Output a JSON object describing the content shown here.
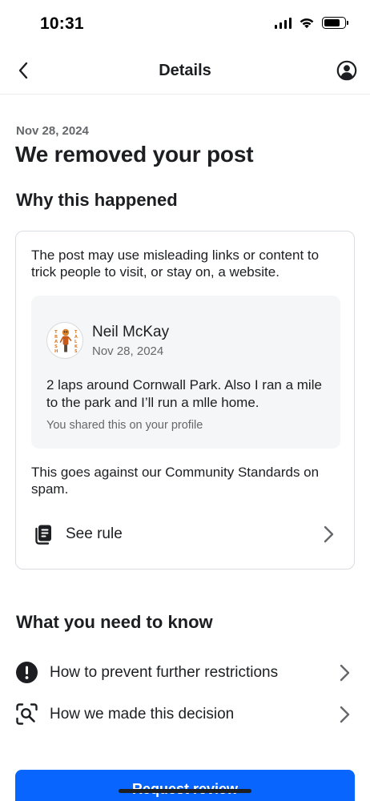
{
  "status_bar": {
    "time": "10:31"
  },
  "nav": {
    "title": "Details",
    "back_icon": "chevron-left-icon",
    "profile_icon": "user-circle-icon"
  },
  "main": {
    "date": "Nov 28, 2024",
    "title": "We removed your post",
    "why_title": "Why this happened",
    "card": {
      "description": "The post may use misleading links or content to trick people to visit, or stay on, a website.",
      "post": {
        "author": "Neil McKay",
        "date": "Nov 28, 2024",
        "text": "2 laps around Cornwall Park. Also I ran a mile to the park and I’ll run a mlle home.",
        "note": "You shared this on your profile",
        "avatar_text_left": "TRASH",
        "avatar_text_right": "TALKERS"
      },
      "standards": "This goes against our Community Standards on spam.",
      "rule_label": "See rule",
      "rule_icon": "rule-book-icon"
    },
    "know_title": "What you need to know",
    "items": [
      {
        "label": "How to prevent further restrictions",
        "icon": "exclamation-circle-icon"
      },
      {
        "label": "How we made this decision",
        "icon": "search-magnifier-icon"
      }
    ],
    "cta_label": "Request review"
  },
  "colors": {
    "accent": "#0866ff",
    "text_primary": "#1c1e21",
    "text_secondary": "#65676b",
    "card_border": "#dadde1",
    "post_background": "#f5f6f7"
  }
}
